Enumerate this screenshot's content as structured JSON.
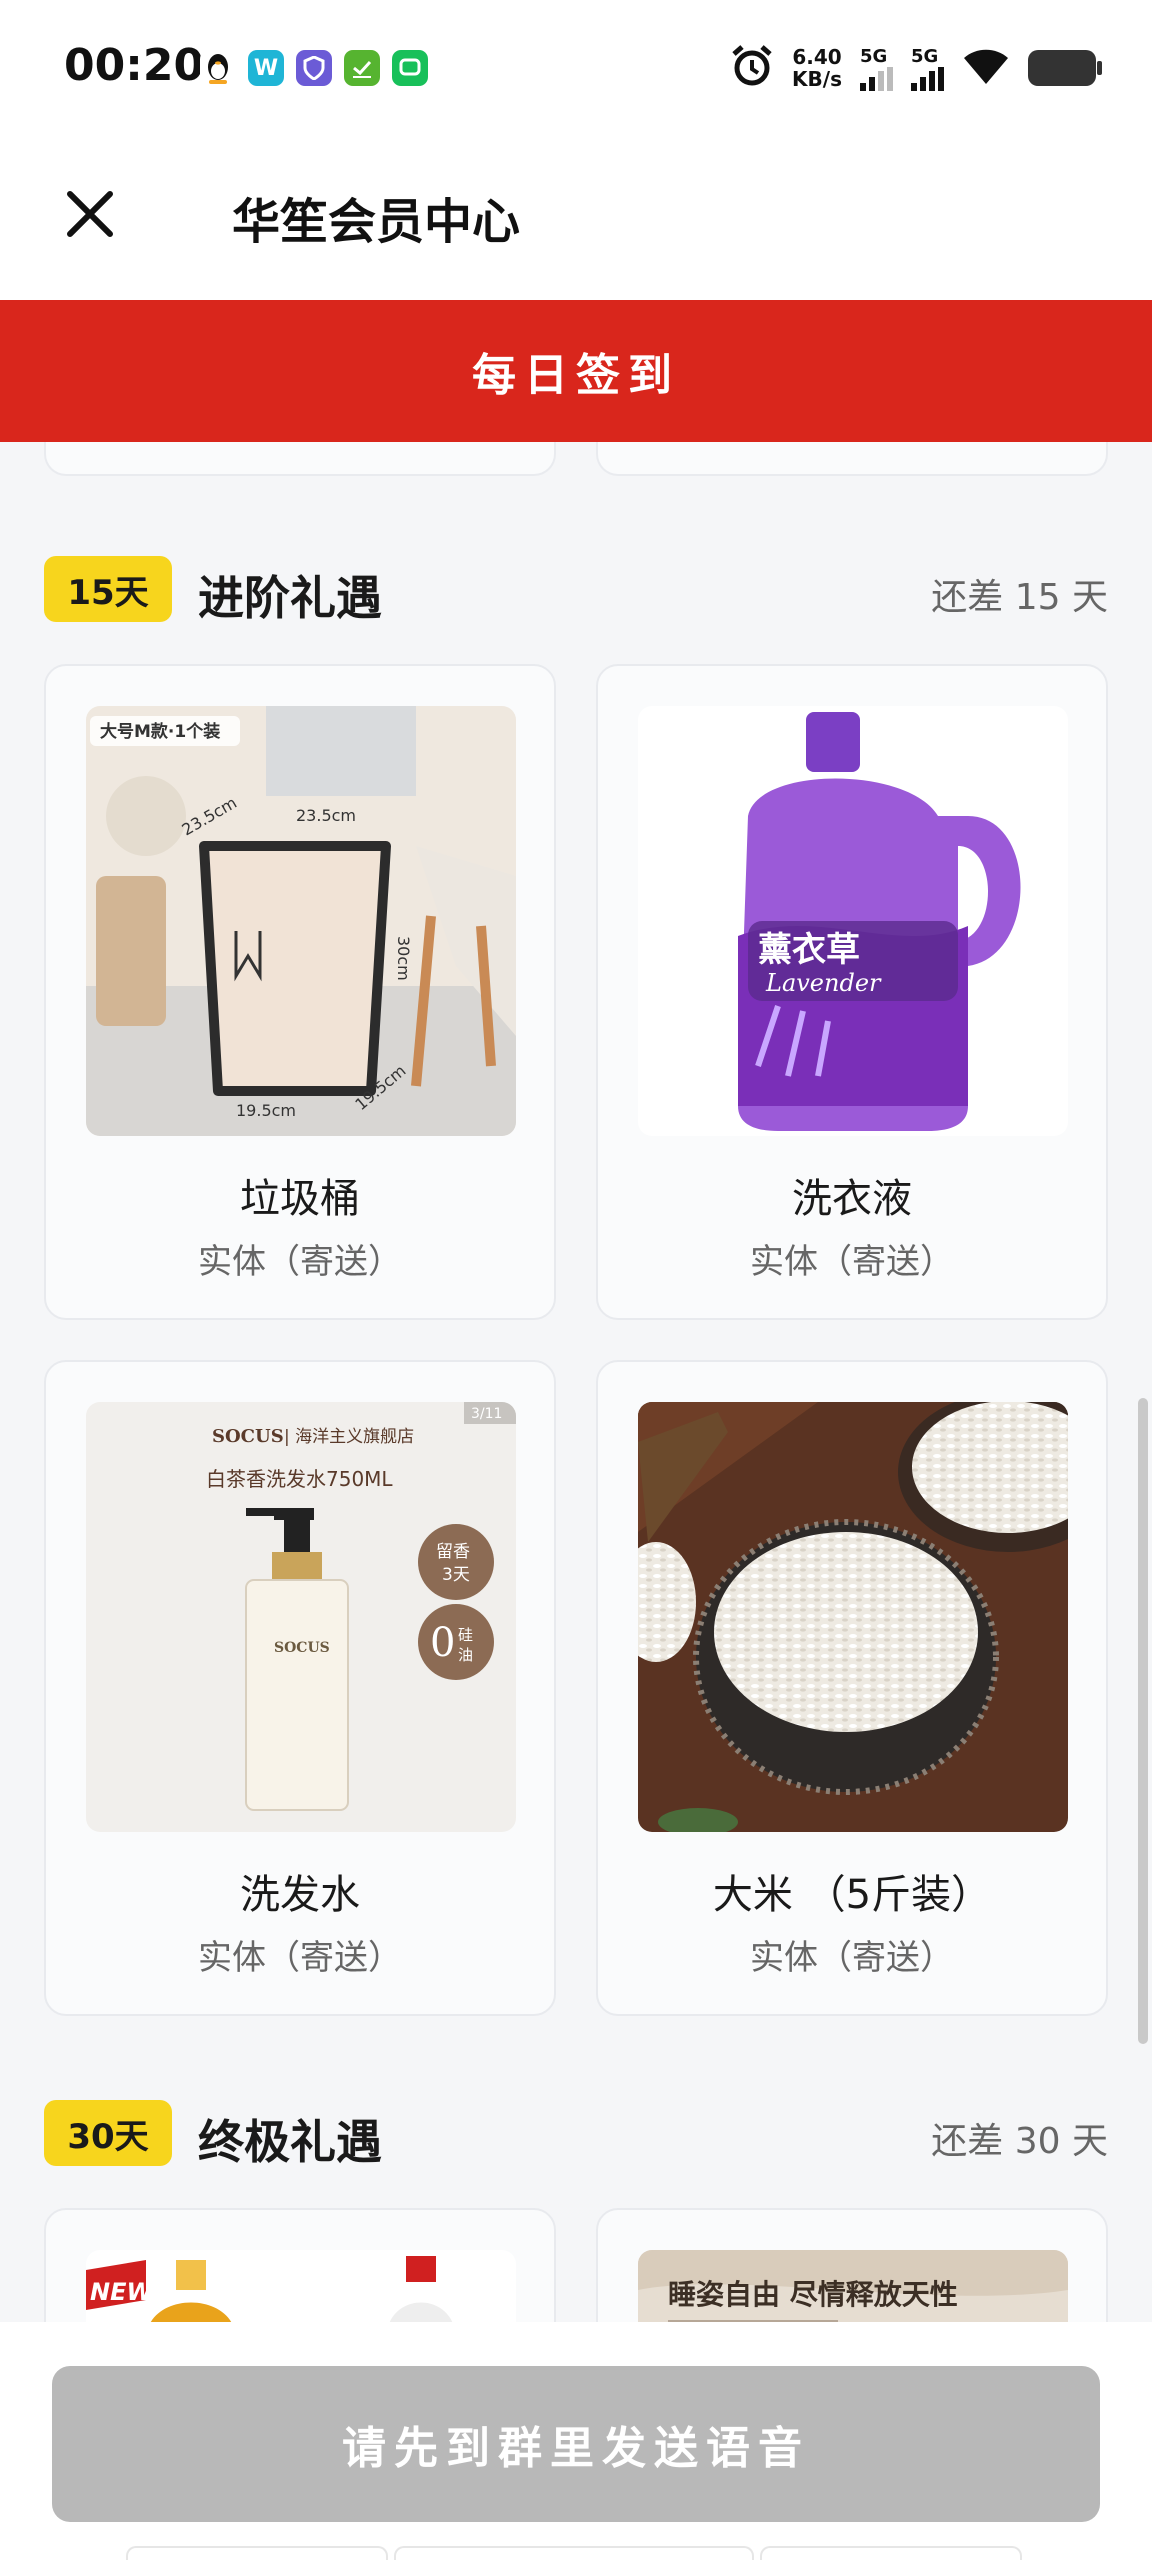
{
  "status_bar": {
    "time": "00:20",
    "net_speed_value": "6.40",
    "net_speed_unit": "KB/s",
    "sim1": "5G",
    "sim2": "5G"
  },
  "header": {
    "title": "华笙会员中心"
  },
  "checkin": {
    "label": "每日签到"
  },
  "sections": [
    {
      "badge": "15天",
      "title": "进阶礼遇",
      "remaining": "还差 15 天",
      "items": [
        {
          "name": "垃圾桶",
          "tag": "实体（寄送）",
          "image_texts": [
            "大号M款·1个装",
            "23.5cm",
            "23.5cm",
            "30cm",
            "19.5cm",
            "19.5cm",
            "M"
          ]
        },
        {
          "name": "洗衣液",
          "tag": "实体（寄送）",
          "image_texts": [
            "薰衣草",
            "Lavender"
          ]
        },
        {
          "name": "洗发水",
          "tag": "实体（寄送）",
          "image_texts": [
            "SOCUS",
            "海洋主义旗舰店",
            "白茶香洗发水750ML",
            "3/11",
            "留香",
            "3天",
            "0",
            "硅油"
          ]
        },
        {
          "name": "大米 （5斤装）",
          "tag": "实体（寄送）",
          "image_texts": []
        }
      ]
    },
    {
      "badge": "30天",
      "title": "终极礼遇",
      "remaining": "还差 30 天",
      "items": [
        {
          "name": "",
          "tag": "",
          "image_texts": [
            "NEW"
          ]
        },
        {
          "name": "",
          "tag": "",
          "image_texts": [
            "睡姿自由 尽情释放天性"
          ]
        }
      ]
    }
  ],
  "cta": {
    "label": "请先到群里发送语音"
  },
  "colors": {
    "checkin_bg": "#d9261c",
    "badge_bg": "#f7d51d",
    "cta_disabled_bg": "#b8b8b8",
    "page_bg": "#f5f6f8"
  },
  "icons": [
    "close-icon",
    "alarm-icon",
    "wifi-icon",
    "battery-icon"
  ]
}
